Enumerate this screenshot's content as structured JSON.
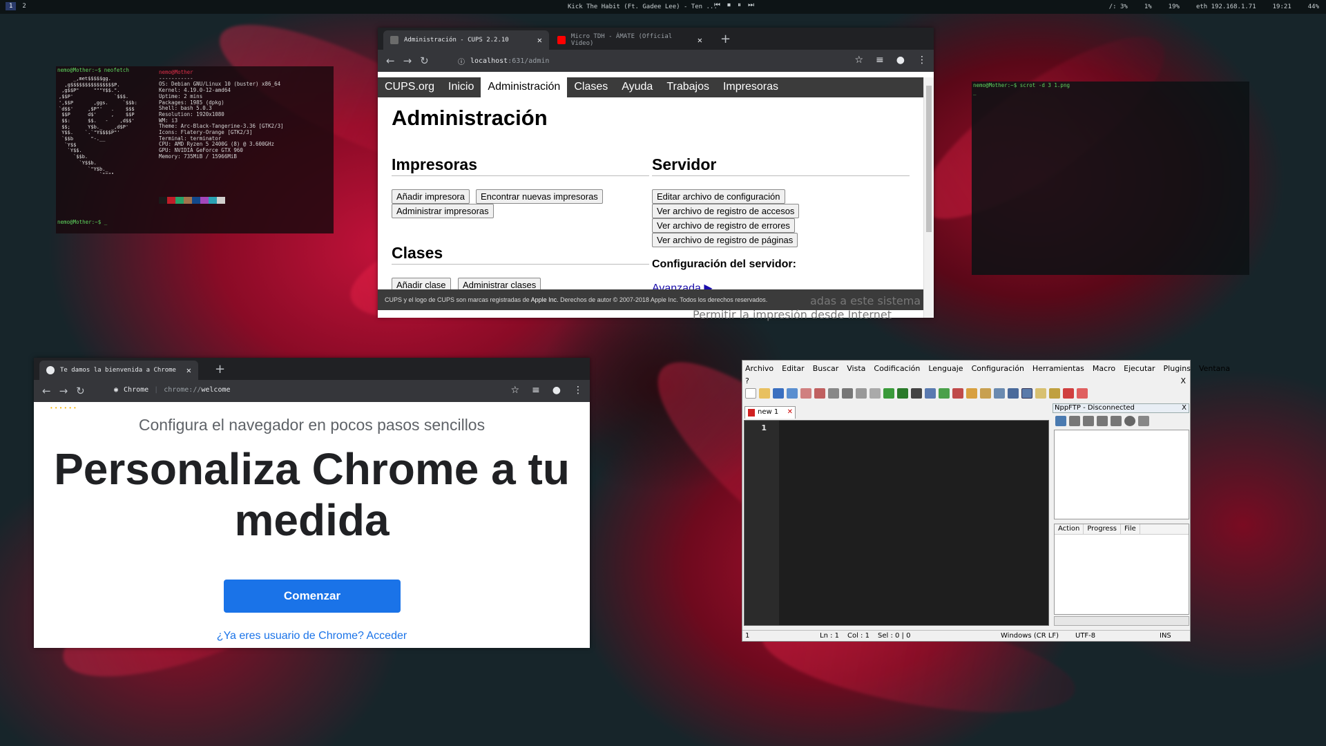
{
  "topbar": {
    "workspaces": [
      "1",
      "2"
    ],
    "now_playing": "Kick The Habit (Ft. Gadee Lee) - Ten ...",
    "media_controls": [
      "⏮",
      "⏹",
      "⏸",
      "⏭"
    ],
    "status": [
      "/: 3%",
      "1%",
      "19%",
      "eth 192.168.1.71",
      "19:21",
      "44%"
    ]
  },
  "term1": {
    "prompt1": "nemo@Mother:~$ neofetch",
    "userhost": "nemo@Mother",
    "separator": "-----------",
    "info": [
      "OS: Debian GNU/Linux 10 (buster) x86_64",
      "Kernel: 4.19.0-12-amd64",
      "Uptime: 2 mins",
      "Packages: 1985 (dpkg)",
      "Shell: bash 5.0.3",
      "Resolution: 1920x1080",
      "WM: i3",
      "Theme: Arc-Black-Tangerine-3.36 [GTK2/3]",
      "Icons: Flatery-Orange [GTK2/3]",
      "Terminal: terminator",
      "CPU: AMD Ryzen 5 2400G (8) @ 3.600GHz",
      "GPU: NVIDIA GeForce GTX 960",
      "Memory: 735MiB / 15966MiB"
    ],
    "logo": "     _,met$$$$$gg.\n  ,g$$$$$$$$$$$$$$$P.\n ,g$$P\"     \"\"\"Y$$.\".\n,$$P'              `$$$.\n',$$P       ,ggs.     `$$b:\n`d$$'     ,$P\"'   .    $$$\n $$P      d$'     ,    $$P\n $$:      $$.   -    ,d$$'\n $$;      Y$b._   _,d$P'\n Y$$.    `.`\"Y$$$$P\"'\n `$$b      \"-.__\n  `Y$$\n   `Y$$.\n     `$$b.\n       `Y$$b.\n          `\"Y$b._\n              `\"\"\"\"",
    "prompt2": "nemo@Mother:~$ _",
    "swatches": [
      "#1a1a1a",
      "#c01c28",
      "#26a269",
      "#a2734c",
      "#12488b",
      "#a347ba",
      "#2aa1b3",
      "#d0cfcc"
    ]
  },
  "term2": {
    "prompt": "nemo@Mother:~$ scrot -d 3 1.png",
    "cursor": "_"
  },
  "cups_window": {
    "tabs": [
      {
        "title": "Administración - CUPS 2.2.10",
        "active": true
      },
      {
        "title": "Micro TDH - ÁMATE (Official Video)",
        "active": false
      }
    ],
    "url_host": "localhost",
    "url_path": ":631/admin",
    "nav": [
      "CUPS.org",
      "Inicio",
      "Administración",
      "Clases",
      "Ayuda",
      "Trabajos",
      "Impresoras"
    ],
    "page_title": "Administración",
    "printers_heading": "Impresoras",
    "printers_buttons": [
      "Añadir impresora",
      "Encontrar nuevas impresoras",
      "Administrar impresoras"
    ],
    "classes_heading": "Clases",
    "classes_buttons": [
      "Añadir clase",
      "Administrar clases"
    ],
    "server_heading": "Servidor",
    "server_buttons": [
      "Editar archivo de configuración",
      "Ver archivo de registro de accesos",
      "Ver archivo de registro de errores",
      "Ver archivo de registro de páginas"
    ],
    "server_config_label": "Configuración del servidor:",
    "advanced_link": "Avanzada ▶",
    "ghost_line1": "adas a este sistema",
    "ghost_line2": "Permitir la impresión desde Internet",
    "footer_pre": "CUPS y el logo de CUPS son marcas registradas de ",
    "footer_apple": "Apple Inc.",
    "footer_post": " Derechos de autor © 2007-2018 Apple Inc. Todos los derechos reservados."
  },
  "welcome_window": {
    "tab_title": "Te damos la bienvenida a Chrome",
    "omni_label": "Chrome",
    "url_scheme": "chrome://",
    "url_path": "welcome",
    "subtitle": "Configura el navegador en pocos pasos sencillos",
    "title": "Personaliza Chrome a tu medida",
    "cta": "Comenzar",
    "signin_link": "¿Ya eres usuario de Chrome? Acceder"
  },
  "npp": {
    "menu": [
      "Archivo",
      "Editar",
      "Buscar",
      "Vista",
      "Codificación",
      "Lenguaje",
      "Configuración",
      "Herramientas",
      "Macro",
      "Ejecutar",
      "Plugins",
      "Ventana"
    ],
    "help": "?",
    "close_x": "X",
    "tab": "new 1",
    "line_number": "1",
    "ftp_title": "NppFTP - Disconnected",
    "ftp_close": "X",
    "queue_columns": [
      "Action",
      "Progress",
      "File"
    ],
    "status": {
      "pos": "1",
      "ln": "Ln : 1",
      "col": "Col : 1",
      "sel": "Sel : 0 | 0",
      "eol": "Windows (CR LF)",
      "enc": "UTF-8",
      "mode": "INS"
    }
  }
}
